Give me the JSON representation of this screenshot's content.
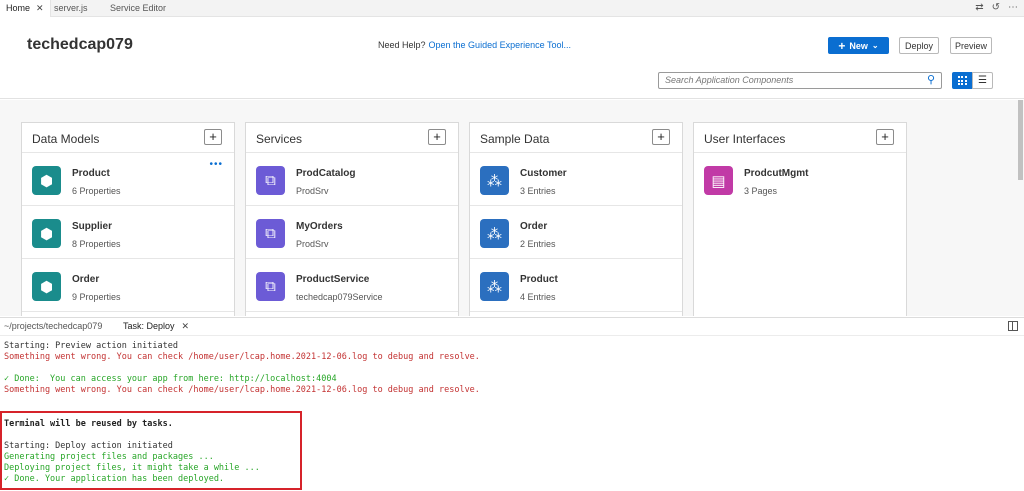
{
  "tabs": [
    {
      "label": "Home",
      "active": true
    },
    {
      "label": "server.js",
      "active": false
    },
    {
      "label": "Service Editor",
      "active": false
    }
  ],
  "header": {
    "project_title": "techedcap079",
    "help_text": "Need Help?",
    "help_link": "Open the Guided Experience Tool...",
    "new_label": "New",
    "deploy_label": "Deploy",
    "preview_label": "Preview",
    "search_placeholder": "Search Application Components"
  },
  "panels": [
    {
      "title": "Data Models",
      "icon_color": "#1a8c8c",
      "items": [
        {
          "name": "Product",
          "sub": "6 Properties"
        },
        {
          "name": "Supplier",
          "sub": "8 Properties"
        },
        {
          "name": "Order",
          "sub": "9 Properties"
        }
      ]
    },
    {
      "title": "Services",
      "icon_color": "#6c5bd6",
      "items": [
        {
          "name": "ProdCatalog",
          "sub": "ProdSrv"
        },
        {
          "name": "MyOrders",
          "sub": "ProdSrv"
        },
        {
          "name": "ProductService",
          "sub": "techedcap079Service"
        }
      ]
    },
    {
      "title": "Sample Data",
      "icon_color": "#2b6fbf",
      "items": [
        {
          "name": "Customer",
          "sub": "3 Entries"
        },
        {
          "name": "Order",
          "sub": "2 Entries"
        },
        {
          "name": "Product",
          "sub": "4 Entries"
        }
      ]
    },
    {
      "title": "User Interfaces",
      "icon_color": "#c13aa6",
      "items": [
        {
          "name": "ProdcutMgmt",
          "sub": "3 Pages"
        }
      ]
    }
  ],
  "terminal": {
    "tabs": [
      {
        "label": "~/projects/techedcap079"
      },
      {
        "label": "Task: Deploy"
      }
    ],
    "lines": [
      "Starting: Preview action initiated",
      "Something went wrong. You can check /home/user/lcap.home.2021-12-06.log to debug and resolve.",
      "✓ Done:  You can access your app from here: http://localhost:4004",
      "Something went wrong. You can check /home/user/lcap.home.2021-12-06.log to debug and resolve.",
      "Terminal will be reused by tasks.",
      "Starting: Deploy action initiated",
      "Generating project files and packages ...",
      "Deploying project files, it might take a while ...",
      "✓ Done. Your application has been deployed."
    ]
  }
}
